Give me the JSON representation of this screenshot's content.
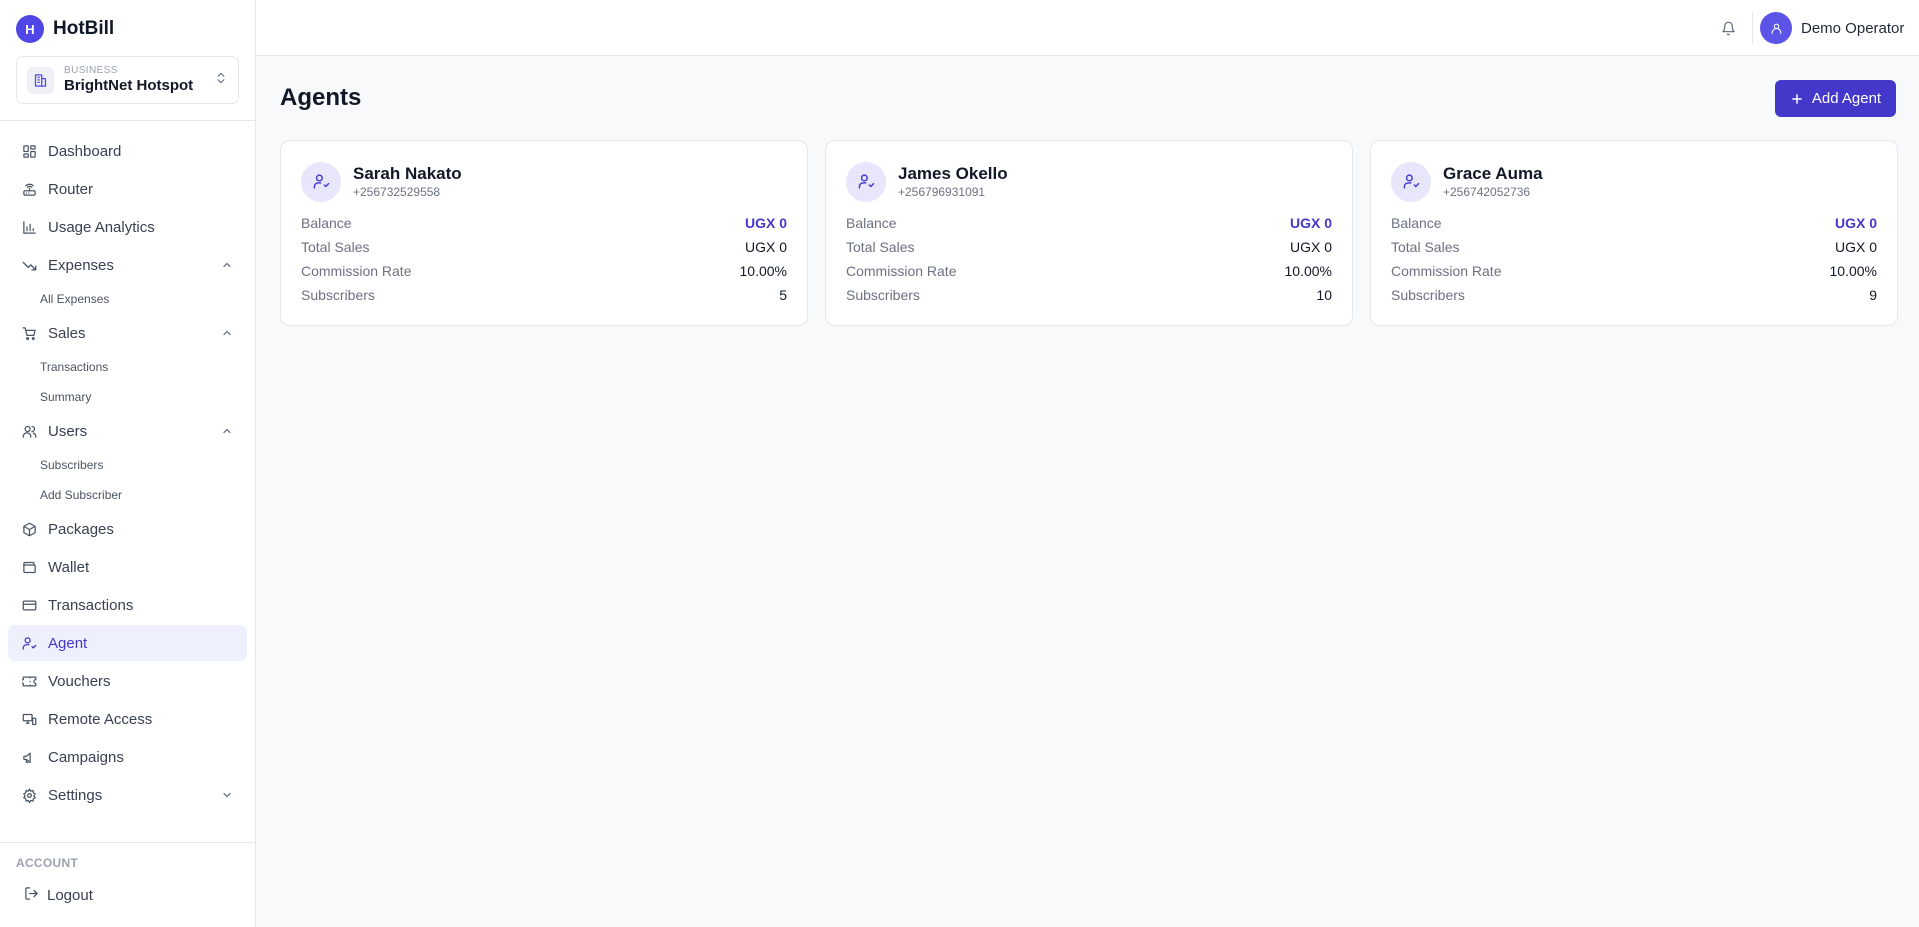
{
  "brand": {
    "logo_letter": "H",
    "name": "HotBill"
  },
  "business": {
    "label": "BUSINESS",
    "name": "BrightNet Hotspot"
  },
  "sidebar": {
    "items": [
      {
        "label": "Dashboard",
        "icon": "dashboard-icon"
      },
      {
        "label": "Router",
        "icon": "router-icon"
      },
      {
        "label": "Usage Analytics",
        "icon": "bar-chart-icon"
      },
      {
        "label": "Expenses",
        "icon": "trending-down-icon",
        "expanded": true,
        "children": [
          "All Expenses"
        ]
      },
      {
        "label": "Sales",
        "icon": "cart-icon",
        "expanded": true,
        "children": [
          "Transactions",
          "Summary"
        ]
      },
      {
        "label": "Users",
        "icon": "users-icon",
        "expanded": true,
        "children": [
          "Subscribers",
          "Add Subscriber"
        ]
      },
      {
        "label": "Packages",
        "icon": "package-icon"
      },
      {
        "label": "Wallet",
        "icon": "wallet-icon"
      },
      {
        "label": "Transactions",
        "icon": "credit-card-icon"
      },
      {
        "label": "Agent",
        "icon": "user-check-icon",
        "active": true
      },
      {
        "label": "Vouchers",
        "icon": "ticket-icon"
      },
      {
        "label": "Remote Access",
        "icon": "monitor-icon"
      },
      {
        "label": "Campaigns",
        "icon": "megaphone-icon"
      },
      {
        "label": "Settings",
        "icon": "gear-icon",
        "expanded": false
      }
    ],
    "account_label": "ACCOUNT",
    "logout_label": "Logout"
  },
  "header": {
    "user_name": "Demo Operator"
  },
  "main": {
    "title": "Agents",
    "add_button_label": "Add Agent",
    "row_labels": {
      "balance": "Balance",
      "total_sales": "Total Sales",
      "commission": "Commission Rate",
      "subscribers": "Subscribers"
    },
    "agents": [
      {
        "name": "Sarah Nakato",
        "phone": "+256732529558",
        "balance": "UGX 0",
        "total_sales": "UGX 0",
        "commission": "10.00%",
        "subscribers": "5"
      },
      {
        "name": "James Okello",
        "phone": "+256796931091",
        "balance": "UGX 0",
        "total_sales": "UGX 0",
        "commission": "10.00%",
        "subscribers": "10"
      },
      {
        "name": "Grace Auma",
        "phone": "+256742052736",
        "balance": "UGX 0",
        "total_sales": "UGX 0",
        "commission": "10.00%",
        "subscribers": "9"
      }
    ]
  },
  "colors": {
    "accent": "#4338ca",
    "brand": "#4f46e5",
    "active_bg": "#eef0fd"
  }
}
